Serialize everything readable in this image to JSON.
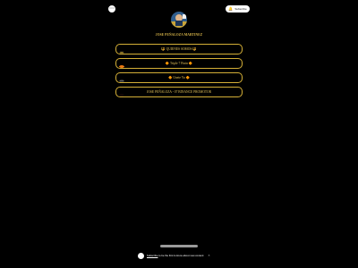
{
  "header": {
    "menu_icon": "ellipsis-icon",
    "subscribe_label": "Subscribe",
    "subscribe_icon": "bell-icon"
  },
  "profile": {
    "name": "JOSE PEÑALOZA MARTINEZ"
  },
  "links": [
    {
      "label": "🔱 QUIENES SOMOS 🔱",
      "icon": "logo-thumbnail"
    },
    {
      "label": "🔶 Triple 7 Bwin 🔶",
      "icon": "orange-logo-thumbnail"
    },
    {
      "label": "🔶 Unete Ya 🔶",
      "icon": "dark-logo-thumbnail"
    },
    {
      "label": "JOSE PEÑALOZA - 07 BINANCE PROMOTOR",
      "icon": "red-logo-thumbnail"
    }
  ],
  "cookie": {
    "link_text": "Subscribe",
    "text": " to be the first to know about new content",
    "close": "×"
  },
  "colors": {
    "background": "#000000",
    "accent_gold": "#d4af37"
  }
}
